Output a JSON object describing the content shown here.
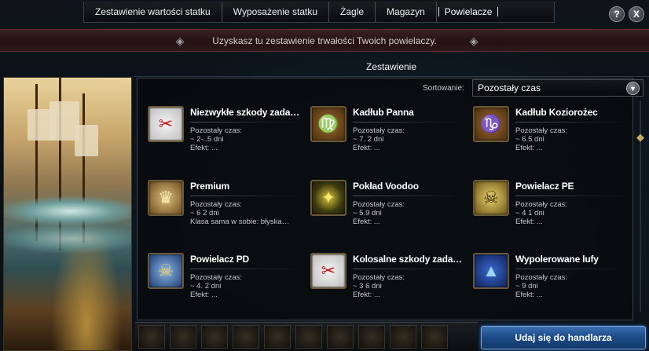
{
  "tabs": [
    {
      "label": "Zestawienie wartości statku"
    },
    {
      "label": "Wyposażenie statku"
    },
    {
      "label": "Żagle"
    },
    {
      "label": "Magazyn"
    },
    {
      "label": "Powielacze"
    }
  ],
  "window_buttons": {
    "help": "?",
    "close": "X"
  },
  "banner": {
    "text": "Uzyskasz tu zestawienie trwałości Twoich powielaczy."
  },
  "section": {
    "title": "Zestawienie"
  },
  "sort": {
    "label": "Sortowanie:",
    "selected": "Pozostały czas",
    "arrow_icon": "chevron-down-icon"
  },
  "items": [
    {
      "name": "Niezwykłe szkody zada…",
      "time_label": "Pozostały czas:",
      "time": "~ 2-..5 dni",
      "effect": "Efekt: ...",
      "icon": "damage-icon"
    },
    {
      "name": "Kadłub Panna",
      "time_label": "Pozostały czas:",
      "time": "~ 7. 2 dni",
      "effect": "Efekt: ...",
      "icon": "virgo-icon"
    },
    {
      "name": "Kadłub Koziorożec",
      "time_label": "Pozostały czas:",
      "time": "~ 6.5 dni",
      "effect": "Efekt: ...",
      "icon": "capricorn-icon"
    },
    {
      "name": "Premium",
      "time_label": "Pozostały czas:",
      "time": "~ 6 2 dni",
      "effect": "Klasa sama w sobie: błyska…",
      "icon": "premium-crest-icon"
    },
    {
      "name": "Pokład Voodoo",
      "time_label": "Pozostały czas:",
      "time": "~ 5.9 dni",
      "effect": "Efekt: ...",
      "icon": "voodoo-icon"
    },
    {
      "name": "Powielacz PE",
      "time_label": "Pozostały czas:",
      "time": "~ 4 1 dni",
      "effect": "Efekt: ...",
      "icon": "skull-gold-icon"
    },
    {
      "name": "Powielacz PD",
      "time_label": "Pozostały czas:",
      "time": "~ 4. 2 dni",
      "effect": "Efekt: ...",
      "icon": "skull-blue-icon"
    },
    {
      "name": "Kolosalne szkody zada…",
      "time_label": "Pozostały czas:",
      "time": "~ 3 6 dni",
      "effect": "Efekt: ...",
      "icon": "colossal-damage-icon"
    },
    {
      "name": "Wypolerowane lufy",
      "time_label": "Pozostały czas:",
      "time": "~ 9 dni",
      "effect": "Efekt: ...",
      "icon": "polished-barrel-icon"
    }
  ],
  "dealer_button": {
    "label": "Udaj się do handlarza"
  },
  "colors": {
    "accent_blue": "#1d4d8a",
    "banner_red": "#2e1819",
    "gold": "#c9a95a"
  }
}
